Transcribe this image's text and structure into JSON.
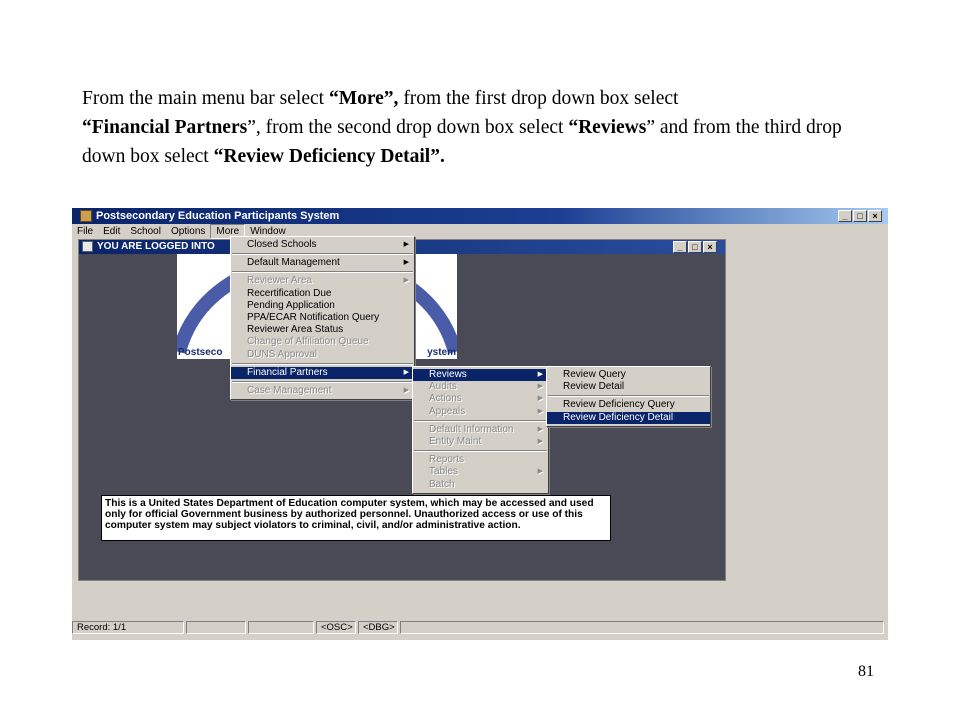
{
  "instructions": {
    "p1": "From the main menu bar select ",
    "b1": "“More”,",
    "p2": " from the first drop down box select ",
    "b2": "“Financial Partners",
    "p3": "”, from the second drop down box select ",
    "b3": "“Reviews",
    "p4": "” and from the third drop down box select ",
    "b4": "“Review Deficiency Detail”."
  },
  "slide_number": "81",
  "app": {
    "title": "Postsecondary Education Participants System",
    "window_buttons": [
      "_",
      "□",
      "×"
    ],
    "menubar": [
      "File",
      "Edit",
      "School",
      "Options",
      "More",
      "Window"
    ],
    "active_menu": "More",
    "child_title": "YOU ARE LOGGED INTO",
    "logo_left": "Postseco",
    "logo_right": "ystem",
    "notice": "This is a United States Department of Education computer system, which may be accessed and used only for official Government business by authorized personnel. Unauthorized access or use of this computer system may subject violators to criminal, civil, and/or administrative action.",
    "status": {
      "record": "Record: 1/1",
      "osc": "<OSC>",
      "dbg": "<DBG>"
    }
  },
  "menus": {
    "more": [
      {
        "label": "Closed Schools",
        "submenu": true,
        "disabled": false
      },
      {
        "label": "Default Management",
        "submenu": true,
        "disabled": false
      },
      {
        "label": "Reviewer Area",
        "submenu": true,
        "disabled": true
      },
      {
        "label": "Recertification Due",
        "submenu": false,
        "disabled": false
      },
      {
        "label": "Pending Application",
        "submenu": false,
        "disabled": false
      },
      {
        "label": "PPA/ECAR Notification Query",
        "submenu": false,
        "disabled": false
      },
      {
        "label": "Reviewer Area Status",
        "submenu": false,
        "disabled": false
      },
      {
        "label": "Change of Affiliation Queue",
        "submenu": false,
        "disabled": true
      },
      {
        "label": "DUNS Approval",
        "submenu": false,
        "disabled": true
      },
      {
        "label": "Financial Partners",
        "submenu": true,
        "disabled": false,
        "highlighted": true
      },
      {
        "label": "Case Management",
        "submenu": true,
        "disabled": true
      }
    ],
    "financial_partners": [
      {
        "label": "Reviews",
        "submenu": true,
        "disabled": false,
        "highlighted": true
      },
      {
        "label": "Audits",
        "submenu": true,
        "disabled": true
      },
      {
        "label": "Actions",
        "submenu": true,
        "disabled": true
      },
      {
        "label": "Appeals",
        "submenu": true,
        "disabled": true
      },
      {
        "label": "Default Information",
        "submenu": true,
        "disabled": true
      },
      {
        "label": "Entity Maint",
        "submenu": true,
        "disabled": true
      },
      {
        "label": "Reports",
        "submenu": false,
        "disabled": true
      },
      {
        "label": "Tables",
        "submenu": true,
        "disabled": true
      },
      {
        "label": "Batch",
        "submenu": false,
        "disabled": true
      }
    ],
    "reviews": [
      {
        "label": "Review Query",
        "disabled": false
      },
      {
        "label": "Review Detail",
        "disabled": false
      },
      {
        "label": "Review Deficiency Query",
        "disabled": false
      },
      {
        "label": "Review Deficiency Detail",
        "disabled": false,
        "highlighted": true
      }
    ],
    "submenu_arrow": "▶"
  },
  "colors": {
    "title_bar": "#0a246a",
    "menu_highlight": "#0a246a",
    "workspace": "#4a4a57",
    "chrome": "#d4d0c8"
  },
  "icons": [
    "app-icon",
    "child-window-icon",
    "submenu-arrow-icon"
  ]
}
